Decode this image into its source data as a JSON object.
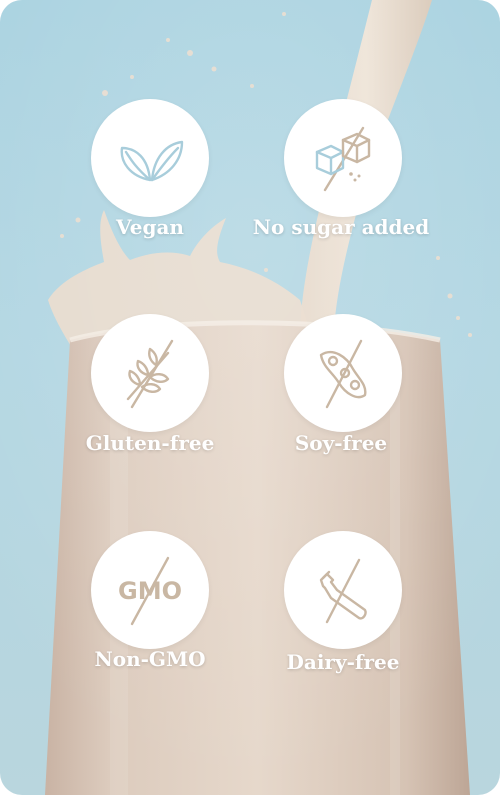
{
  "colors": {
    "background": "#a9d2e0",
    "badge": "#ffffff",
    "icon_blue": "#a8cddb",
    "icon_tan": "#c9b7a3",
    "label": "#ffffff"
  },
  "features": [
    {
      "label": "Vegan",
      "icon": "leaves-icon"
    },
    {
      "label": "No sugar added",
      "icon": "sugar-cubes-crossed-icon"
    },
    {
      "label": "Gluten-free",
      "icon": "wheat-crossed-icon"
    },
    {
      "label": "Soy-free",
      "icon": "soybean-crossed-icon"
    },
    {
      "label": "Non-GMO",
      "icon": "gmo-crossed-icon",
      "icon_text": "GMO"
    },
    {
      "label": "Dairy-free",
      "icon": "milk-bottle-crossed-icon"
    }
  ]
}
